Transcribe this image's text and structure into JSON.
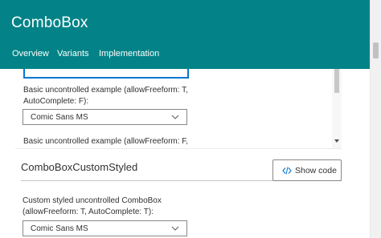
{
  "header": {
    "title": "ComboBox",
    "nav": [
      "Overview",
      "Variants",
      "Implementation"
    ],
    "background": "#038387"
  },
  "example": {
    "label1": "Basic uncontrolled example (allowFreeform: T, AutoComplete: F):",
    "combo1_value": "Comic Sans MS",
    "label2": "Basic uncontrolled example (allowFreeform: F,"
  },
  "custom_section": {
    "title": "ComboBoxCustomStyled",
    "show_code_label": "Show code",
    "label": "Custom styled uncontrolled ComboBox (allowFreeform: T, AutoComplete: T):",
    "combo_value": "Comic Sans MS"
  },
  "icons": [
    "chevron-down-icon",
    "code-icon",
    "scroll-down-arrow-icon"
  ]
}
